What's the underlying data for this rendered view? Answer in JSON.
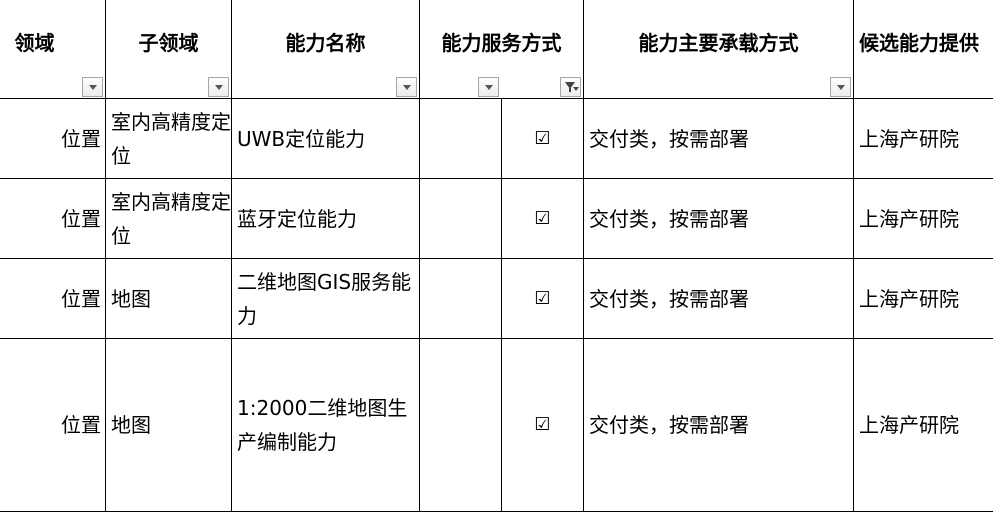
{
  "headers": [
    {
      "label": "领域",
      "filter": "dropdown"
    },
    {
      "label": "子领域",
      "filter": "dropdown"
    },
    {
      "label": "能力名称",
      "filter": "dropdown"
    },
    {
      "label": "能力服务方式",
      "filter": "dropdown"
    },
    {
      "label": "",
      "filter": "filtered"
    },
    {
      "label": "能力主要承载方式",
      "filter": "dropdown"
    },
    {
      "label": "候选能力提供",
      "filter": "none"
    }
  ],
  "rows": [
    {
      "domain": "位置",
      "subdomain": "室内高精度定位",
      "name": "UWB定位能力",
      "service": "",
      "check": "☑",
      "carrier": "交付类，按需部署",
      "provider": "上海产研院"
    },
    {
      "domain": "位置",
      "subdomain": "室内高精度定位",
      "name": "蓝牙定位能力",
      "service": "",
      "check": "☑",
      "carrier": "交付类，按需部署",
      "provider": "上海产研院"
    },
    {
      "domain": "位置",
      "subdomain": "地图",
      "name": "二维地图GIS服务能力",
      "service": "",
      "check": "☑",
      "carrier": "交付类，按需部署",
      "provider": "上海产研院"
    },
    {
      "domain": "位置",
      "subdomain": "地图",
      "name": "1:2000二维地图生产编制能力",
      "service": "",
      "check": "☑",
      "carrier": "交付类，按需部署",
      "provider": "上海产研院"
    }
  ]
}
